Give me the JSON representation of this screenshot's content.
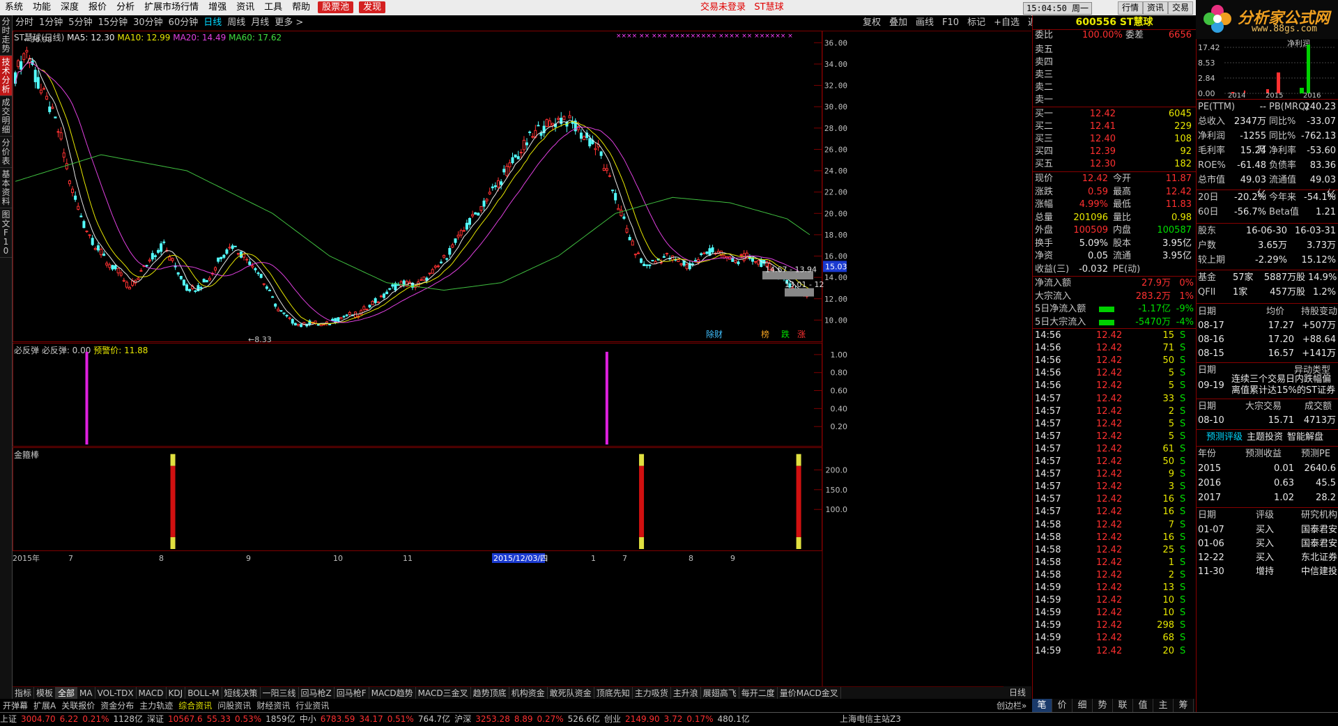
{
  "menu": [
    "系统",
    "功能",
    "深度",
    "报价",
    "分析",
    "扩展市场行情",
    "增强",
    "资讯",
    "工具",
    "帮助"
  ],
  "menu_buttons": [
    "股票池",
    "发现"
  ],
  "login_status": "交易未登录",
  "stock_name_top": "ST慧球",
  "clock": "15:04:50 周一",
  "top_right_buttons": [
    "行情",
    "资讯",
    "交易"
  ],
  "logo": {
    "text": "分析家公式网",
    "url": "www.88gs.com"
  },
  "vtabs": [
    {
      "label": "分时走势",
      "active": false
    },
    {
      "label": "技术分析",
      "active": true
    },
    {
      "label": "成交明细",
      "active": false
    },
    {
      "label": "分价表",
      "active": false
    },
    {
      "label": "基本资料",
      "active": false
    },
    {
      "label": "图文F10",
      "active": false
    }
  ],
  "periods": [
    {
      "label": "分时",
      "sel": false
    },
    {
      "label": "1分钟",
      "sel": false
    },
    {
      "label": "5分钟",
      "sel": false
    },
    {
      "label": "15分钟",
      "sel": false
    },
    {
      "label": "30分钟",
      "sel": false
    },
    {
      "label": "60分钟",
      "sel": false
    },
    {
      "label": "日线",
      "sel": true
    },
    {
      "label": "周线",
      "sel": false
    },
    {
      "label": "月线",
      "sel": false
    },
    {
      "label": "更多 >",
      "sel": false
    }
  ],
  "toolbar": [
    "复权",
    "叠加",
    "画线",
    "F10",
    "标记",
    "+自选",
    "返回"
  ],
  "main_chart": {
    "title": "ST慧球(日线)",
    "ma_labels": [
      {
        "text": "MA5: 12.30",
        "color": "#e8e8e8"
      },
      {
        "text": "MA10: 12.99",
        "color": "#e8e800"
      },
      {
        "text": "MA20: 14.49",
        "color": "#e040e0"
      },
      {
        "text": "MA60: 17.62",
        "color": "#40e040"
      }
    ],
    "high_label": "36.98",
    "low_label": "8.33",
    "price_tag": "15.03",
    "annot1": "14.67 - 13.94",
    "annot2": "13.01 - 12",
    "markers": [
      "除财",
      "榜",
      "跌",
      "涨"
    ],
    "x_labels": [
      "2015年",
      "7",
      "8",
      "9",
      "10",
      "11",
      "2015/12/03/四",
      "1",
      "7",
      "8",
      "9"
    ]
  },
  "sub1": {
    "title": "必反弹",
    "value_text": "必反弹: 0.00",
    "warn_text": "预警价: 11.88"
  },
  "sub2": {
    "title": "金箍棒"
  },
  "period_right": "日线",
  "idx_tabs": [
    "指标",
    "模板",
    "全部",
    "MA",
    "VOL-TDX",
    "MACD",
    "KDJ",
    "BOLL-M",
    "短线决策",
    "一阳三线",
    "回马枪Z",
    "回马枪F",
    "MACD趋势",
    "MACD三金叉",
    "趋势顶底",
    "机构资金",
    "敢死队资金",
    "顶底先知",
    "主力吸货",
    "主升浪",
    "展翅高飞",
    "每开二度",
    "量价MACD金叉"
  ],
  "sub_tabs": [
    "开弹幕",
    "扩展A",
    "关联报价",
    "资金分布",
    "主力轨迹",
    "综合资讯",
    "问股资讯",
    "财经资讯",
    "行业资讯"
  ],
  "sub_tabs_right": "创边栏»",
  "chart_data": {
    "type": "candlestick",
    "title": "ST慧球(日线)",
    "ylim": [
      8,
      37
    ],
    "yticks": [
      10,
      12,
      14,
      16,
      18,
      20,
      22,
      24,
      26,
      28,
      30,
      32,
      34,
      36
    ],
    "x_labels": [
      "2015年",
      "7",
      "8",
      "9",
      "10",
      "11",
      "2015/12/03/四",
      "1",
      "7",
      "8",
      "9"
    ],
    "high": 36.98,
    "low": 8.33,
    "close_anchors": [
      [
        0,
        33.0
      ],
      [
        4,
        35.5
      ],
      [
        8,
        32
      ],
      [
        12,
        30
      ],
      [
        16,
        27
      ],
      [
        20,
        22
      ],
      [
        24,
        19
      ],
      [
        28,
        17
      ],
      [
        32,
        15.5
      ],
      [
        36,
        14.5
      ],
      [
        40,
        13
      ],
      [
        44,
        14.5
      ],
      [
        48,
        16
      ],
      [
        52,
        17
      ],
      [
        56,
        15
      ],
      [
        60,
        13
      ],
      [
        64,
        13
      ],
      [
        68,
        14
      ],
      [
        72,
        16
      ],
      [
        76,
        17
      ],
      [
        80,
        16
      ],
      [
        84,
        15
      ],
      [
        88,
        13
      ],
      [
        92,
        11
      ],
      [
        96,
        10
      ],
      [
        100,
        9.5
      ],
      [
        104,
        9.8
      ],
      [
        108,
        9.5
      ],
      [
        112,
        10
      ],
      [
        116,
        10.5
      ],
      [
        120,
        10.5
      ],
      [
        124,
        11.5
      ],
      [
        128,
        12
      ],
      [
        132,
        13
      ],
      [
        136,
        13.5
      ],
      [
        140,
        13.2
      ],
      [
        144,
        14
      ],
      [
        148,
        15
      ],
      [
        152,
        16.5
      ],
      [
        156,
        18
      ],
      [
        160,
        19.5
      ],
      [
        164,
        21
      ],
      [
        168,
        22.5
      ],
      [
        172,
        24
      ],
      [
        176,
        25.5
      ],
      [
        180,
        27
      ],
      [
        184,
        28
      ],
      [
        188,
        28.5
      ],
      [
        192,
        29
      ],
      [
        196,
        28
      ],
      [
        200,
        27
      ],
      [
        204,
        26
      ],
      [
        208,
        23
      ],
      [
        212,
        20
      ],
      [
        216,
        17
      ],
      [
        220,
        15
      ],
      [
        224,
        15.5
      ],
      [
        228,
        16
      ],
      [
        232,
        15.5
      ],
      [
        236,
        15
      ],
      [
        240,
        16
      ],
      [
        244,
        16.5
      ],
      [
        248,
        16
      ],
      [
        252,
        15.5
      ],
      [
        256,
        16
      ],
      [
        260,
        15.5
      ],
      [
        264,
        15
      ],
      [
        268,
        14
      ],
      [
        272,
        13
      ],
      [
        276,
        12.5
      ],
      [
        278,
        12.4
      ]
    ],
    "ma60_anchors": [
      [
        0,
        23
      ],
      [
        30,
        25.5
      ],
      [
        60,
        24
      ],
      [
        90,
        20
      ],
      [
        110,
        16
      ],
      [
        130,
        13.5
      ],
      [
        150,
        12.8
      ],
      [
        170,
        13.5
      ],
      [
        190,
        16
      ],
      [
        210,
        20
      ],
      [
        230,
        21.5
      ],
      [
        250,
        21
      ],
      [
        270,
        19.5
      ],
      [
        278,
        18
      ]
    ],
    "sub1": {
      "name": "必反弹",
      "ylim": [
        0,
        1.1
      ],
      "yticks": [
        0.2,
        0.4,
        0.6,
        0.8,
        1.0
      ],
      "signals": [
        25,
        207
      ]
    },
    "sub2": {
      "name": "金箍棒",
      "ylim": [
        0,
        250
      ],
      "yticks": [
        100,
        150,
        200
      ],
      "bars": [
        55,
        219,
        274
      ]
    }
  },
  "quote": {
    "code": "600556",
    "name": "ST慧球",
    "weibi_label": "委比",
    "weibi": "100.00%",
    "weicha_label": "委差",
    "weicha": "6656",
    "sell": [
      {
        "l": "卖五",
        "p": "",
        "v": ""
      },
      {
        "l": "卖四",
        "p": "",
        "v": ""
      },
      {
        "l": "卖三",
        "p": "",
        "v": ""
      },
      {
        "l": "卖二",
        "p": "",
        "v": ""
      },
      {
        "l": "卖一",
        "p": "",
        "v": ""
      }
    ],
    "buy": [
      {
        "l": "买一",
        "p": "12.42",
        "v": "6045"
      },
      {
        "l": "买二",
        "p": "12.41",
        "v": "229"
      },
      {
        "l": "买三",
        "p": "12.40",
        "v": "108"
      },
      {
        "l": "买四",
        "p": "12.39",
        "v": "92"
      },
      {
        "l": "买五",
        "p": "12.30",
        "v": "182"
      }
    ],
    "stats": [
      {
        "l1": "现价",
        "v1": "12.42",
        "l2": "今开",
        "v2": "11.87",
        "c1": "#ff3030",
        "c2": "#ff3030"
      },
      {
        "l1": "涨跌",
        "v1": "0.59",
        "l2": "最高",
        "v2": "12.42",
        "c1": "#ff3030",
        "c2": "#ff3030"
      },
      {
        "l1": "涨幅",
        "v1": "4.99%",
        "l2": "最低",
        "v2": "11.83",
        "c1": "#ff3030",
        "c2": "#ff3030"
      },
      {
        "l1": "总量",
        "v1": "201096",
        "l2": "量比",
        "v2": "0.98",
        "c1": "#e8e800",
        "c2": "#e8e800"
      },
      {
        "l1": "外盘",
        "v1": "100509",
        "l2": "内盘",
        "v2": "100587",
        "c1": "#ff3030",
        "c2": "#00e000"
      },
      {
        "l1": "换手",
        "v1": "5.09%",
        "l2": "股本",
        "v2": "3.95亿",
        "c1": "#e8e8e8",
        "c2": "#e8e8e8"
      },
      {
        "l1": "净资",
        "v1": "0.05",
        "l2": "流通",
        "v2": "3.95亿",
        "c1": "#e8e8e8",
        "c2": "#e8e8e8"
      },
      {
        "l1": "收益(三)",
        "v1": "-0.032",
        "l2": "PE(动)",
        "v2": "",
        "c1": "#e8e8e8",
        "c2": "#e8e8e8"
      }
    ],
    "flows": [
      {
        "l": "净流入额",
        "v": "27.9万",
        "p": "0%",
        "c": "#ff3030"
      },
      {
        "l": "大宗流入",
        "v": "283.2万",
        "p": "1%",
        "c": "#ff3030"
      },
      {
        "l": "5日净流入额",
        "v": "-1.17亿",
        "p": "-9%",
        "c": "#00e000"
      },
      {
        "l": "5日大宗流入",
        "v": "-5470万",
        "p": "-4%",
        "c": "#00e000"
      }
    ],
    "ticks": [
      [
        "14:56",
        "12.42",
        "15",
        "S"
      ],
      [
        "14:56",
        "12.42",
        "71",
        "S"
      ],
      [
        "14:56",
        "12.42",
        "50",
        "S"
      ],
      [
        "14:56",
        "12.42",
        "5",
        "S"
      ],
      [
        "14:56",
        "12.42",
        "5",
        "S"
      ],
      [
        "14:57",
        "12.42",
        "33",
        "S"
      ],
      [
        "14:57",
        "12.42",
        "2",
        "S"
      ],
      [
        "14:57",
        "12.42",
        "5",
        "S"
      ],
      [
        "14:57",
        "12.42",
        "5",
        "S"
      ],
      [
        "14:57",
        "12.42",
        "61",
        "S"
      ],
      [
        "14:57",
        "12.42",
        "50",
        "S"
      ],
      [
        "14:57",
        "12.42",
        "9",
        "S"
      ],
      [
        "14:57",
        "12.42",
        "3",
        "S"
      ],
      [
        "14:57",
        "12.42",
        "16",
        "S"
      ],
      [
        "14:57",
        "12.42",
        "16",
        "S"
      ],
      [
        "14:58",
        "12.42",
        "7",
        "S"
      ],
      [
        "14:58",
        "12.42",
        "16",
        "S"
      ],
      [
        "14:58",
        "12.42",
        "25",
        "S"
      ],
      [
        "14:58",
        "12.42",
        "1",
        "S"
      ],
      [
        "14:58",
        "12.42",
        "2",
        "S"
      ],
      [
        "14:59",
        "12.42",
        "13",
        "S"
      ],
      [
        "14:59",
        "12.42",
        "10",
        "S"
      ],
      [
        "14:59",
        "12.42",
        "10",
        "S"
      ],
      [
        "14:59",
        "12.42",
        "298",
        "S"
      ],
      [
        "14:59",
        "12.42",
        "68",
        "S"
      ],
      [
        "14:59",
        "12.42",
        "20",
        "S"
      ]
    ]
  },
  "quote_tabs": [
    "笔",
    "价",
    "细",
    "势",
    "联",
    "值",
    "主",
    "筹"
  ],
  "f10": {
    "chart": {
      "yticks": [
        "17.42",
        "8.53",
        "2.84",
        "0.00"
      ],
      "years": [
        "2014",
        "2015",
        "2016"
      ],
      "title": "净利润"
    },
    "pe": [
      {
        "l1": "PE(TTM)",
        "v1": "--",
        "l2": "PB(MRQ)",
        "v2": "240.23"
      },
      {
        "l1": "总收入",
        "v1": "2347万",
        "l2": "同比%",
        "v2": "-33.07"
      },
      {
        "l1": "净利润",
        "v1": "-1255万",
        "l2": "同比%",
        "v2": "-762.13"
      },
      {
        "l1": "毛利率",
        "v1": "15.24",
        "l2": "净利率",
        "v2": "-53.60"
      },
      {
        "l1": "ROE%",
        "v1": "-61.48",
        "l2": "负债率",
        "v2": "83.36"
      },
      {
        "l1": "总市值",
        "v1": "49.03亿",
        "l2": "流通值",
        "v2": "49.03亿"
      }
    ],
    "perf": [
      {
        "l1": "20日",
        "v1": "-20.2%",
        "l2": "今年来",
        "v2": "-54.1%"
      },
      {
        "l1": "60日",
        "v1": "-56.7%",
        "l2": "Beta值",
        "v2": "1.21"
      }
    ],
    "holders": [
      {
        "l": "股东",
        "a": "16-06-30",
        "b": "16-03-31"
      },
      {
        "l": "户数",
        "a": "3.65万",
        "b": "3.73万"
      },
      {
        "l": "较上期",
        "a": "-2.29%",
        "b": "15.12%"
      }
    ],
    "funds": [
      {
        "l": "基金",
        "a": "57家",
        "b": "5887万股",
        "c": "14.9%"
      },
      {
        "l": "QFII",
        "a": "1家",
        "b": "457万股",
        "c": "1.2%"
      }
    ],
    "trades_header": [
      "日期",
      "均价",
      "持股变动"
    ],
    "trades": [
      [
        "08-17",
        "17.27",
        "+507万"
      ],
      [
        "08-16",
        "17.20",
        "+88.64万"
      ],
      [
        "08-15",
        "16.57",
        "+141万"
      ]
    ],
    "anomaly_header": [
      "日期",
      "异动类型"
    ],
    "anomaly": {
      "date": "09-19",
      "text1": "连续三个交易日内跌幅偏",
      "text2": "离值累计达15%的ST证券"
    },
    "block_header": [
      "日期",
      "大宗交易",
      "成交额"
    ],
    "block": [
      "08-10",
      "15.71",
      "4713万"
    ],
    "tabs": [
      "预测评级",
      "主题投资",
      "智能解盘"
    ],
    "forecast_header": [
      "年份",
      "预测收益",
      "预测PE"
    ],
    "forecast": [
      [
        "2015",
        "0.01",
        "2640.6"
      ],
      [
        "2016",
        "0.63",
        "45.5"
      ],
      [
        "2017",
        "1.02",
        "28.2"
      ]
    ],
    "rating_header": [
      "日期",
      "评级",
      "研究机构"
    ],
    "ratings": [
      [
        "01-07",
        "买入",
        "国泰君安"
      ],
      [
        "01-06",
        "买入",
        "国泰君安"
      ],
      [
        "12-22",
        "买入",
        "东北证券"
      ],
      [
        "11-30",
        "增持",
        "中信建投"
      ]
    ]
  },
  "status": {
    "items": [
      {
        "t": "上证",
        "c": "#c8c8c8"
      },
      {
        "t": "3004.70",
        "c": "#ff3030"
      },
      {
        "t": "6.22",
        "c": "#ff3030"
      },
      {
        "t": "0.21%",
        "c": "#ff3030"
      },
      {
        "t": "1128亿",
        "c": "#c8c8c8"
      },
      {
        "t": "深证",
        "c": "#c8c8c8"
      },
      {
        "t": "10567.6",
        "c": "#ff3030"
      },
      {
        "t": "55.33",
        "c": "#ff3030"
      },
      {
        "t": "0.53%",
        "c": "#ff3030"
      },
      {
        "t": "1859亿",
        "c": "#c8c8c8"
      },
      {
        "t": "中小",
        "c": "#c8c8c8"
      },
      {
        "t": "6783.59",
        "c": "#ff3030"
      },
      {
        "t": "34.17",
        "c": "#ff3030"
      },
      {
        "t": "0.51%",
        "c": "#ff3030"
      },
      {
        "t": "764.7亿",
        "c": "#c8c8c8"
      },
      {
        "t": "沪深",
        "c": "#c8c8c8"
      },
      {
        "t": "3253.28",
        "c": "#ff3030"
      },
      {
        "t": "8.89",
        "c": "#ff3030"
      },
      {
        "t": "0.27%",
        "c": "#ff3030"
      },
      {
        "t": "526.6亿",
        "c": "#c8c8c8"
      },
      {
        "t": "创业",
        "c": "#c8c8c8"
      },
      {
        "t": "2149.90",
        "c": "#ff3030"
      },
      {
        "t": "3.72",
        "c": "#ff3030"
      },
      {
        "t": "0.17%",
        "c": "#ff3030"
      },
      {
        "t": "480.1亿",
        "c": "#c8c8c8"
      }
    ],
    "server": "上海电信主站Z3"
  }
}
